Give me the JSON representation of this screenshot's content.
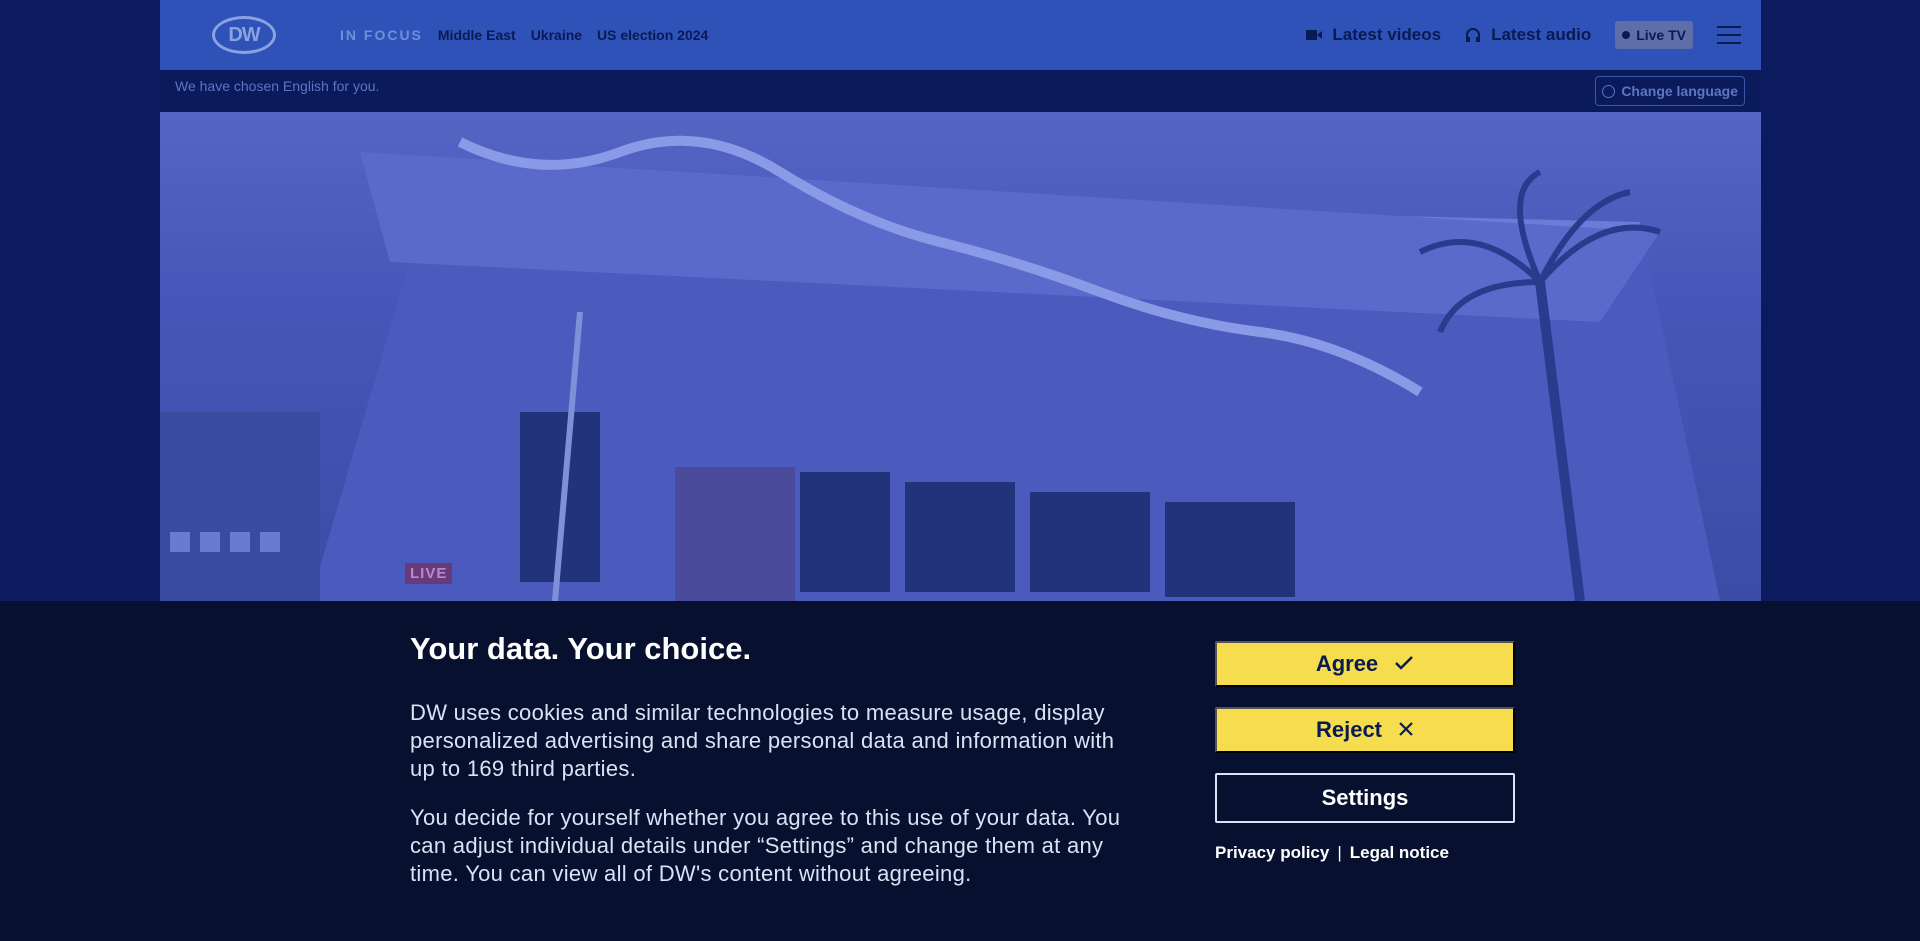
{
  "header": {
    "logo_text": "DW",
    "nav": {
      "focus_label": "IN FOCUS",
      "links": [
        "Middle East",
        "Ukraine",
        "US election 2024"
      ]
    },
    "latest_videos": "Latest videos",
    "latest_audio": "Latest audio",
    "live_tv": "Live TV"
  },
  "language_bar": {
    "message": "We have chosen English for you.",
    "change_language": "Change language"
  },
  "hero": {
    "live_badge": "LIVE"
  },
  "cookie_banner": {
    "title": "Your data. Your choice.",
    "paragraph1": "DW uses cookies and similar technologies to measure usage, display personalized advertising and share personal data and information with up to 169 third parties.",
    "paragraph2": "You decide for yourself whether you agree to this use of your data. You can adjust individual details under “Settings” and change them at any time. You can view all of DW's content without agreeing.",
    "agree_label": "Agree",
    "reject_label": "Reject",
    "settings_label": "Settings",
    "privacy_policy": "Privacy policy",
    "legal_notice": "Legal notice"
  },
  "colors": {
    "header_bg": "#2e52b8",
    "banner_bg": "#07102e",
    "button_yellow": "#f5dd4e"
  }
}
